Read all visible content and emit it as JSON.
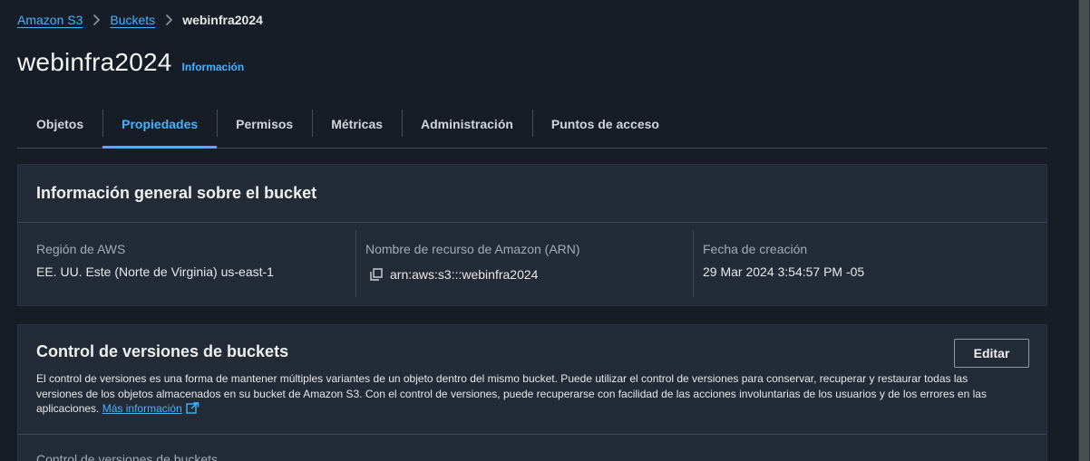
{
  "breadcrumb": {
    "items": [
      "Amazon S3",
      "Buckets"
    ],
    "current": "webinfra2024"
  },
  "page": {
    "title": "webinfra2024",
    "info_link": "Información"
  },
  "tabs": [
    {
      "label": "Objetos",
      "active": false
    },
    {
      "label": "Propiedades",
      "active": true
    },
    {
      "label": "Permisos",
      "active": false
    },
    {
      "label": "Métricas",
      "active": false
    },
    {
      "label": "Administración",
      "active": false
    },
    {
      "label": "Puntos de acceso",
      "active": false
    }
  ],
  "general": {
    "title": "Información general sobre el bucket",
    "region_label": "Región de AWS",
    "region_value": "EE. UU. Este (Norte de Virginia) us-east-1",
    "arn_label": "Nombre de recurso de Amazon (ARN)",
    "arn_value": "arn:aws:s3:::webinfra2024",
    "created_label": "Fecha de creación",
    "created_value": "29 Mar 2024 3:54:57 PM -05"
  },
  "versioning": {
    "title": "Control de versiones de buckets",
    "edit_label": "Editar",
    "description": "El control de versiones es una forma de mantener múltiples variantes de un objeto dentro del mismo bucket. Puede utilizar el control de versiones para conservar, recuperar y restaurar todas las versiones de los objetos almacenados en su bucket de Amazon S3. Con el control de versiones, puede recuperarse con facilidad de las acciones involuntarias de los usuarios y de los errores en las aplicaciones.",
    "more_info_link": "Más información",
    "sub_label": "Control de versiones de buckets"
  },
  "colors": {
    "background": "#161d26",
    "panel": "#232b37",
    "accent": "#42b4ff"
  },
  "icons": [
    "chevron-right-icon",
    "copy-icon",
    "external-link-icon"
  ]
}
